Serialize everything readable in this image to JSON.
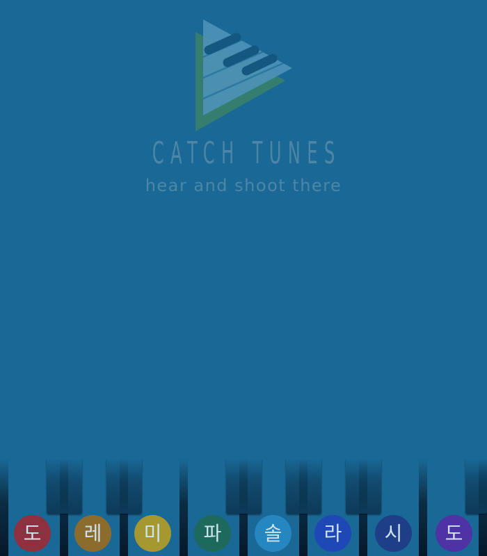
{
  "app": {
    "logo_icon": "piano-triangle-logo",
    "title": "CATCH TUNES",
    "subtitle": "hear and shoot there"
  },
  "colors": {
    "background": "#1a6896",
    "title": "#4d86a6"
  },
  "keyboard": {
    "keys": [
      {
        "label": "도",
        "color": "#8f3040"
      },
      {
        "label": "레",
        "color": "#8c6c2c"
      },
      {
        "label": "미",
        "color": "#a69830"
      },
      {
        "label": "파",
        "color": "#1d6a5c"
      },
      {
        "label": "솔",
        "color": "#2586c0"
      },
      {
        "label": "라",
        "color": "#1e48b5"
      },
      {
        "label": "시",
        "color": "#1e3f88"
      },
      {
        "label": "도",
        "color": "#4e33a5"
      }
    ]
  }
}
